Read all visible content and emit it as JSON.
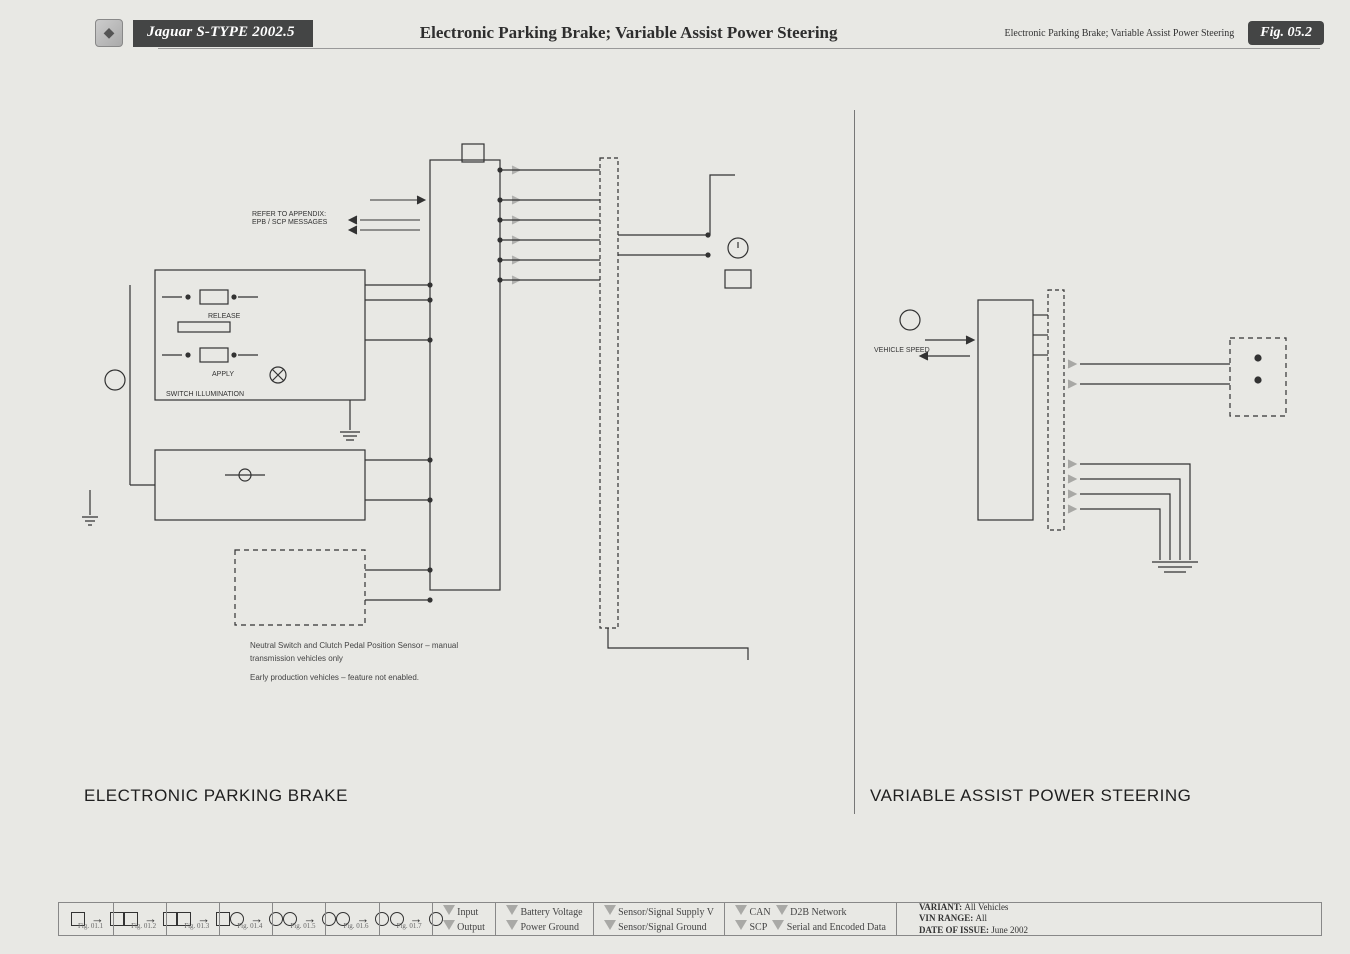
{
  "header": {
    "model": "Jaguar S-TYPE 2002.5",
    "main_title": "Electronic Parking Brake; Variable Assist Power Steering",
    "sub_title": "Electronic Parking Brake; Variable Assist Power Steering",
    "fig_tag": "Fig. 05.2"
  },
  "sections": {
    "left": "ELECTRONIC PARKING BRAKE",
    "right": "VARIABLE ASSIST POWER STEERING"
  },
  "diagram_text": {
    "refer_appendix": "REFER TO APPENDIX:\nEPB / SCP MESSAGES",
    "release": "RELEASE",
    "apply": "APPLY",
    "switch_illum": "SWITCH ILLUMINATION",
    "vehicle_speed": "VEHICLE SPEED",
    "note1": "Neutral Switch and Clutch Pedal Position Sensor – manual\ntransmission vehicles only",
    "note2": "Early production vehicles – feature not enabled."
  },
  "legend": {
    "figs": [
      "Fig. 01.1",
      "Fig. 01.2",
      "Fig. 01.3",
      "Fig. 01.4",
      "Fig. 01.5",
      "Fig. 01.6",
      "Fig. 01.7"
    ],
    "io": {
      "input": "Input",
      "output": "Output"
    },
    "power": {
      "batt": "Battery Voltage",
      "pground": "Power Ground"
    },
    "signal": {
      "supply": "Sensor/Signal Supply V",
      "sground": "Sensor/Signal Ground"
    },
    "net": {
      "can": "CAN",
      "d2b": "D2B Network",
      "scp": "SCP",
      "serial": "Serial and Encoded Data"
    },
    "variant_label": "VARIANT:",
    "variant_val": "All Vehicles",
    "vin_label": "VIN RANGE:",
    "vin_val": "All",
    "date_label": "DATE OF ISSUE:",
    "date_val": "June 2002"
  }
}
